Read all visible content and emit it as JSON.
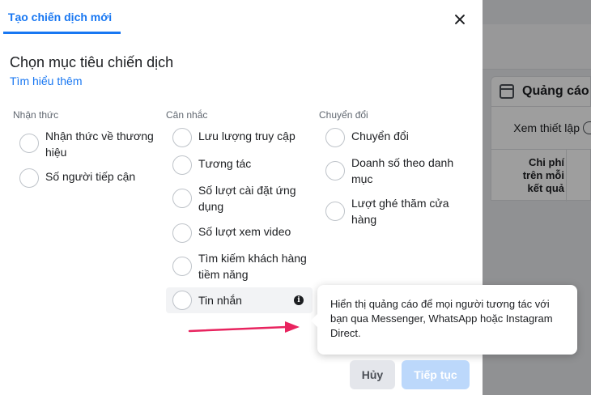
{
  "background": {
    "tab_label": "Quảng cáo",
    "settings_label": "Xem thiết lập",
    "column_header": "Chi phí trên mỗi kết quả"
  },
  "modal": {
    "tab_label": "Tạo chiến dịch mới",
    "heading": "Chọn mục tiêu chiến dịch",
    "learn_more": "Tìm hiểu thêm",
    "columns": [
      {
        "title": "Nhận thức",
        "options": [
          "Nhận thức về thương hiệu",
          "Số người tiếp cận"
        ]
      },
      {
        "title": "Cân nhắc",
        "options": [
          "Lưu lượng truy cập",
          "Tương tác",
          "Số lượt cài đặt ứng dụng",
          "Số lượt xem video",
          "Tìm kiếm khách hàng tiềm năng",
          "Tin nhắn"
        ]
      },
      {
        "title": "Chuyển đổi",
        "options": [
          "Chuyển đổi",
          "Doanh số theo danh mục",
          "Lượt ghé thăm cửa hàng"
        ]
      }
    ],
    "tooltip": "Hiển thị quảng cáo để mọi người tương tác với bạn qua Messenger, WhatsApp hoặc Instagram Direct.",
    "cancel_label": "Hủy",
    "continue_label": "Tiếp tục"
  },
  "colors": {
    "accent": "#1877f2",
    "arrow": "#e8245f",
    "continue_disabled": "#bcd8fb"
  }
}
